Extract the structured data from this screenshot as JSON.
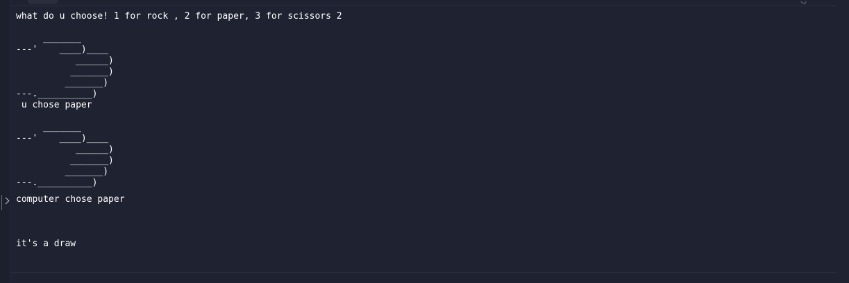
{
  "terminal": {
    "prompt_line": "what do u choose! 1 for rock , 2 for paper, 3 for scissors 2",
    "user_art": [
      "     _______",
      "---'    ____)____",
      "           ______)",
      "          _______)",
      "         _______)",
      "---.__________)"
    ],
    "user_choice": " u chose paper",
    "computer_art": [
      "     _______",
      "---'    ____)____",
      "           ______)",
      "          _______)",
      "         _______)",
      "---.__________)"
    ],
    "computer_choice": "computer chose paper",
    "result": "it's a draw"
  },
  "icons": {
    "expand": "chevron-right-icon"
  }
}
